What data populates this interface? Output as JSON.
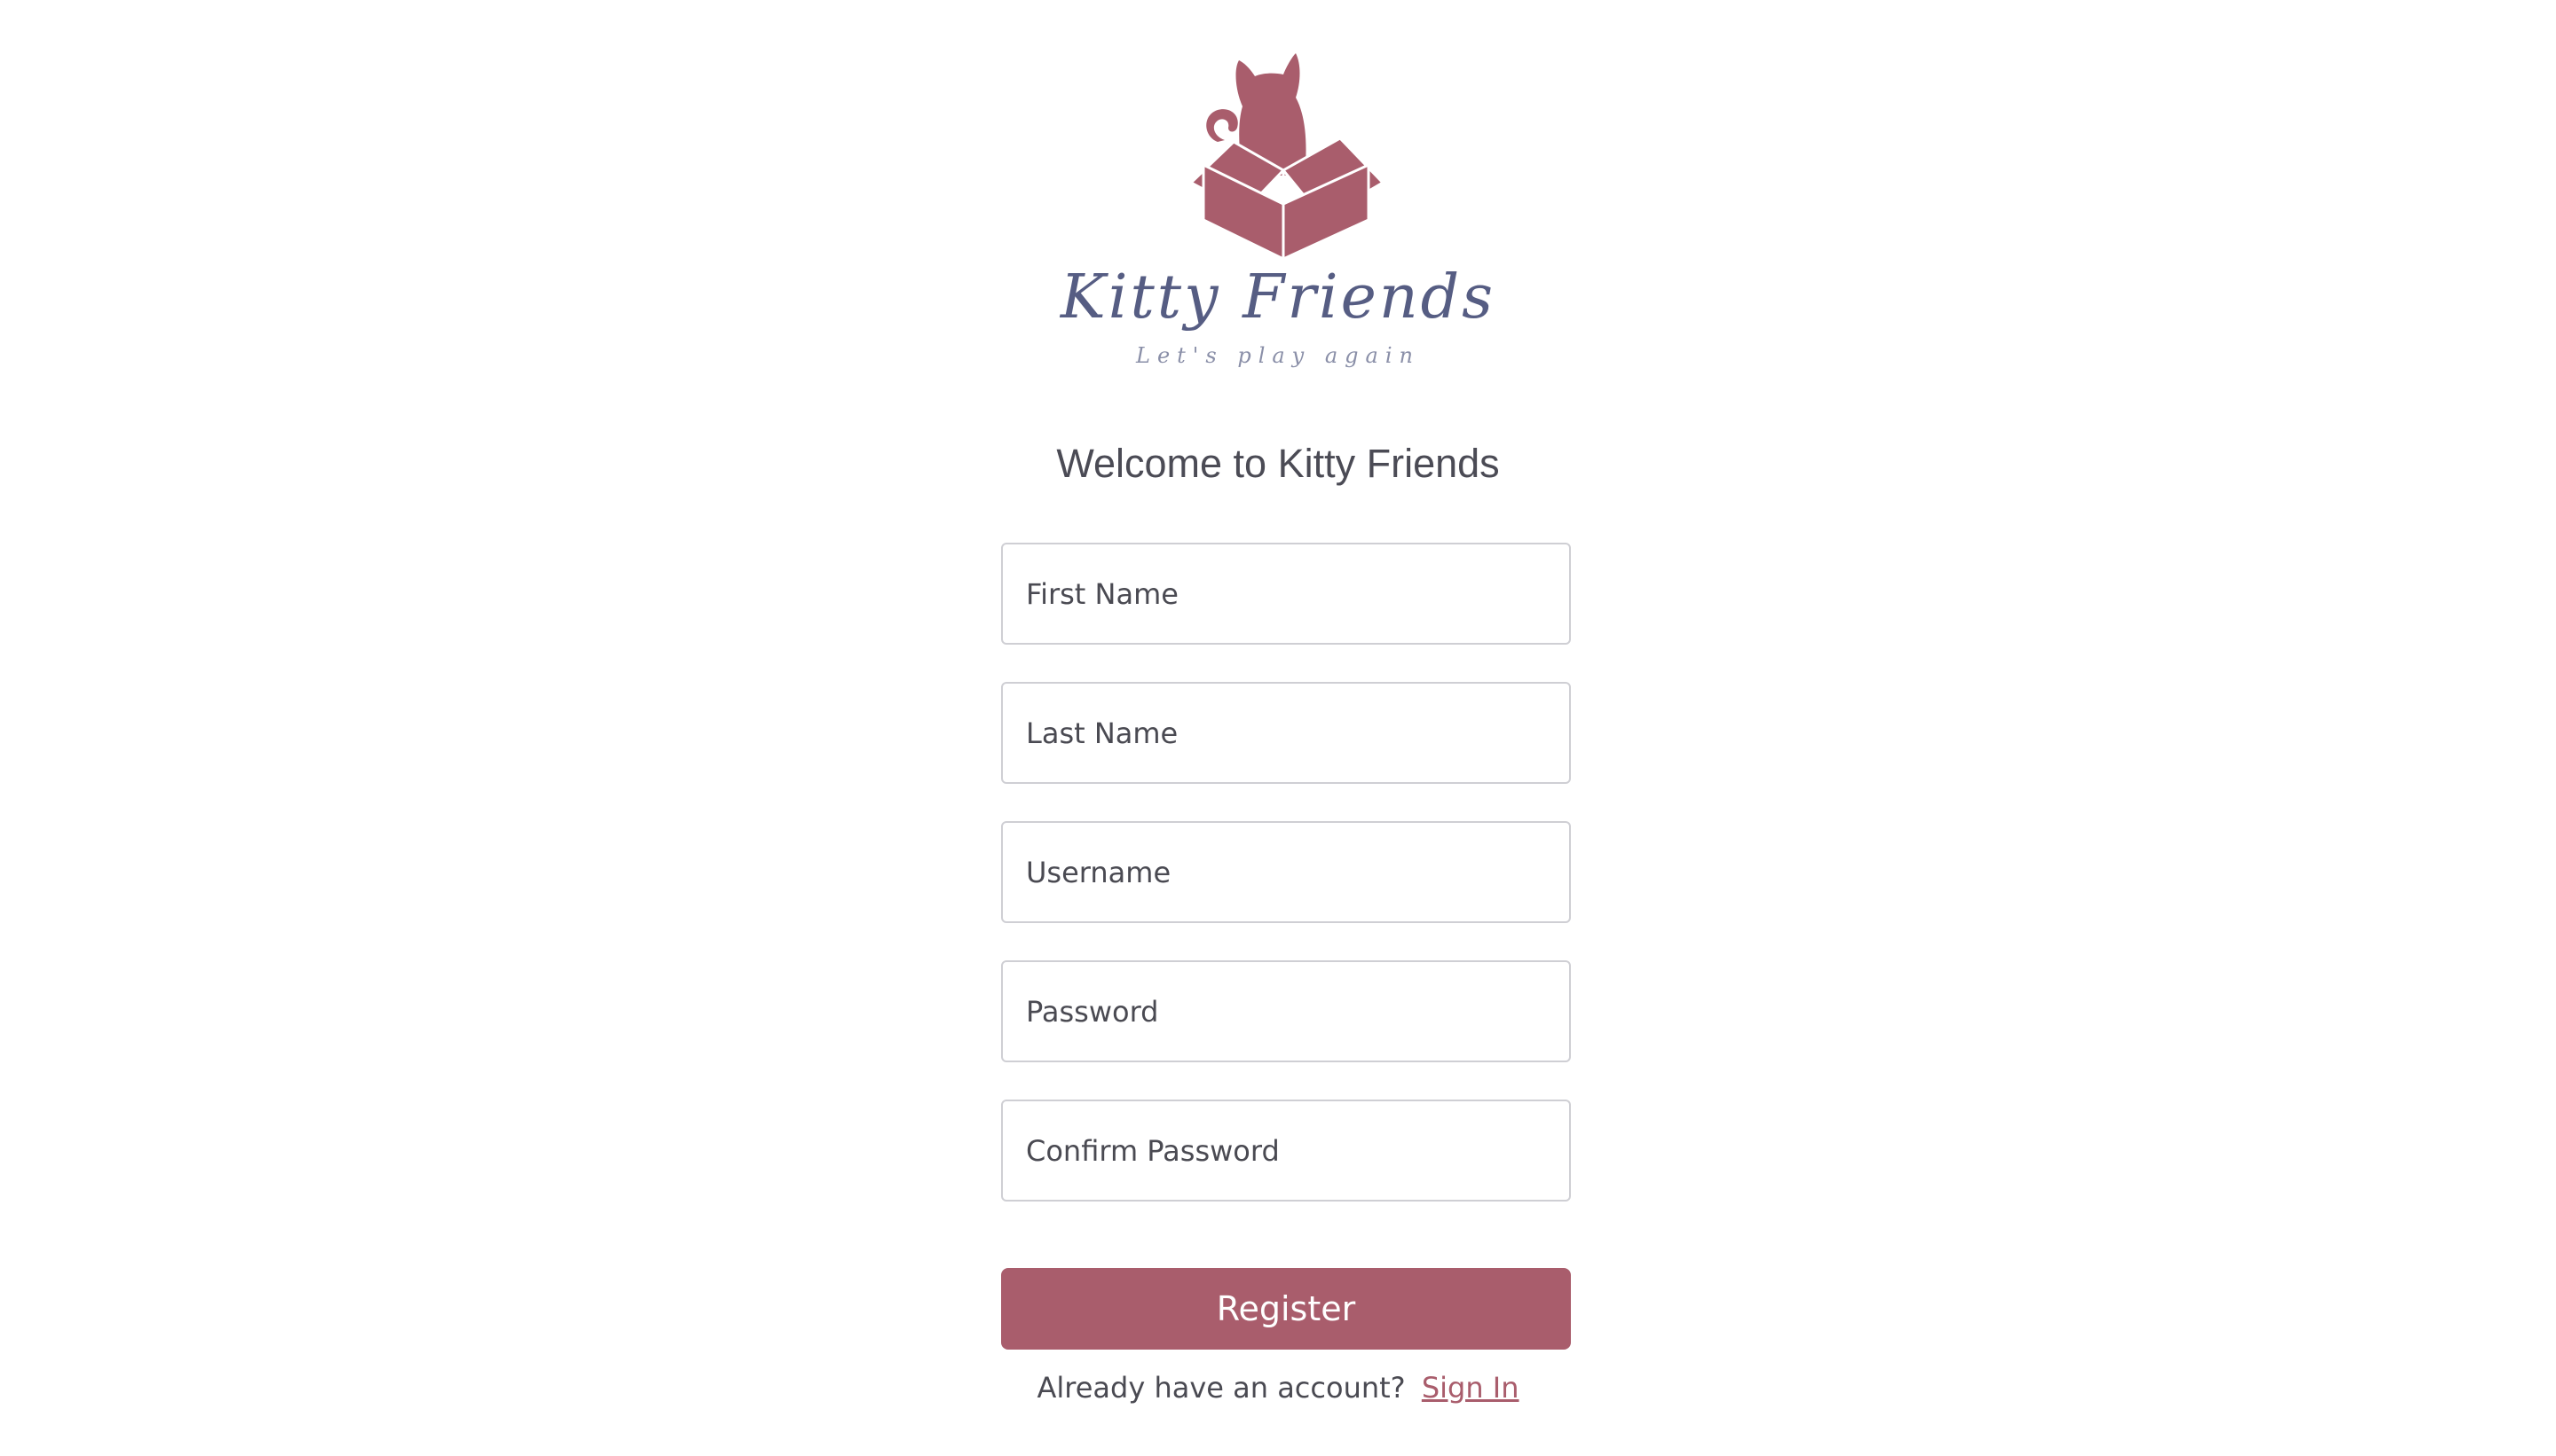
{
  "brand": {
    "name": "Kitty Friends",
    "tagline": "Let's play again",
    "logo_icon": "cat-in-box-icon"
  },
  "heading": {
    "welcome": "Welcome to Kitty Friends"
  },
  "form": {
    "first_name_placeholder": "First Name",
    "last_name_placeholder": "Last Name",
    "username_placeholder": "Username",
    "password_placeholder": "Password",
    "confirm_password_placeholder": "Confirm Password",
    "register_label": "Register"
  },
  "footer": {
    "prompt": "Already have an account?",
    "signin_label": "Sign In"
  },
  "colors": {
    "accent": "#a95d6c",
    "brand_text": "#565d83",
    "field_border": "#cfcfd4"
  }
}
